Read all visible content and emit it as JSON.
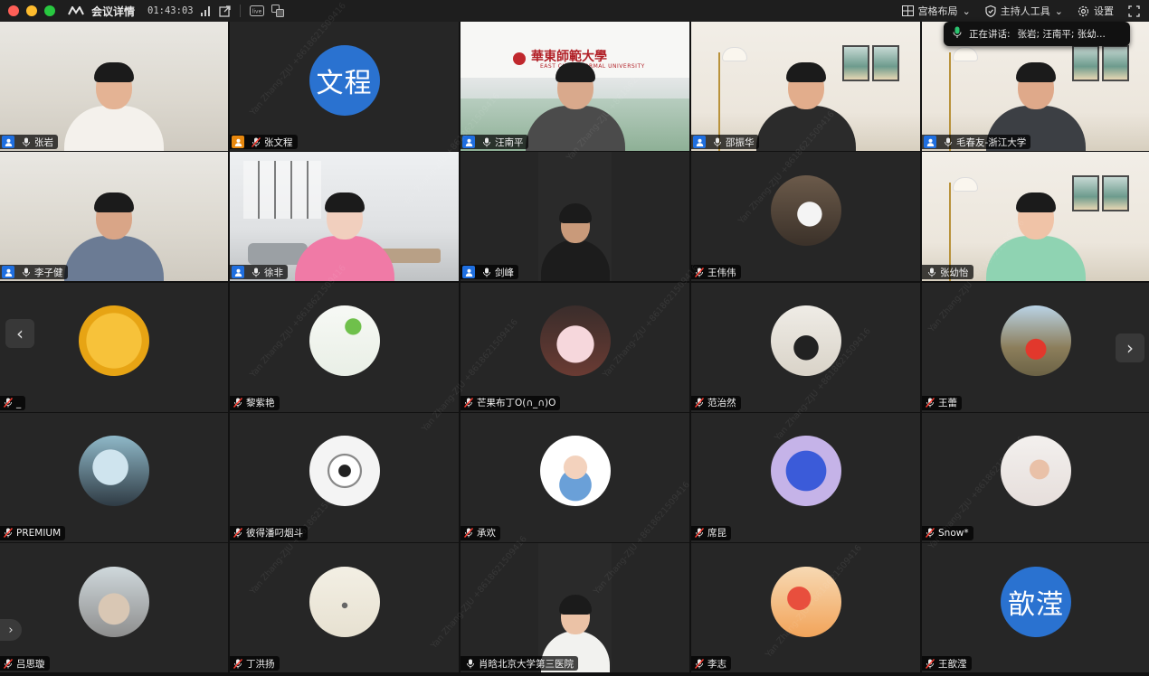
{
  "titlebar": {
    "meeting_info_label": "会议详情",
    "elapsed_time": "01:43:03",
    "right": {
      "layout_label": "宫格布局",
      "host_tools_label": "主持人工具",
      "settings_label": "设置"
    }
  },
  "speaking": {
    "label": "正在讲话:",
    "names": "张岩; 汪南平; 张幼..."
  },
  "participants": [
    {
      "name": "张岩",
      "kind": "video",
      "host": true,
      "host_color": "#1f6fe0",
      "active": true
    },
    {
      "name": "张文程",
      "kind": "text-avatar",
      "avatar_text": "文程",
      "host": true,
      "host_color": "#e8880e"
    },
    {
      "name": "汪南平",
      "kind": "video",
      "host": true,
      "host_color": "#1f6fe0",
      "banner": "華東師範大學",
      "banner_en": "EAST CHINA NORMAL UNIVERSITY"
    },
    {
      "name": "邵振华",
      "kind": "video",
      "host": true,
      "host_color": "#1f6fe0"
    },
    {
      "name": "毛春友-浙江大学",
      "kind": "video",
      "host": true,
      "host_color": "#1f6fe0"
    },
    {
      "name": "李子健",
      "kind": "video",
      "host": true,
      "host_color": "#1f6fe0"
    },
    {
      "name": "徐非",
      "kind": "video",
      "host": true,
      "host_color": "#1f6fe0"
    },
    {
      "name": "剑峰",
      "kind": "video",
      "host": true,
      "host_color": "#1f6fe0"
    },
    {
      "name": "王伟伟",
      "kind": "avatar",
      "avatar": "cat-photo-avatar"
    },
    {
      "name": "张幼怡",
      "kind": "video",
      "host": false
    },
    {
      "name": "_",
      "kind": "avatar",
      "avatar": "golden-mascot-avatar"
    },
    {
      "name": "黎紫艳",
      "kind": "avatar",
      "avatar": "plant-photo-avatar"
    },
    {
      "name": "芒果布丁O(∩_∩)O",
      "kind": "avatar",
      "avatar": "plush-toy-avatar"
    },
    {
      "name": "范治然",
      "kind": "avatar",
      "avatar": "child-photo-avatar"
    },
    {
      "name": "王蕾",
      "kind": "avatar",
      "avatar": "landscape-photo-avatar"
    },
    {
      "name": "PREMIUM",
      "kind": "avatar",
      "avatar": "anime-character-avatar"
    },
    {
      "name": "彼得潘叼烟斗",
      "kind": "avatar",
      "avatar": "eye-sketch-avatar"
    },
    {
      "name": "承欢",
      "kind": "avatar",
      "avatar": "cartoon-girl-avatar"
    },
    {
      "name": "席昆",
      "kind": "avatar",
      "avatar": "molecule-avatar"
    },
    {
      "name": "Snow*",
      "kind": "avatar",
      "avatar": "zju-photo-avatar"
    },
    {
      "name": "吕思璇",
      "kind": "avatar",
      "avatar": "group-photo-avatar"
    },
    {
      "name": "丁洪扬",
      "kind": "avatar",
      "avatar": "ink-painting-avatar"
    },
    {
      "name": "肖晗北京大学第三医院",
      "kind": "video",
      "host": false
    },
    {
      "name": "李志",
      "kind": "avatar",
      "avatar": "cartoon-scene-avatar"
    },
    {
      "name": "王歆滢",
      "kind": "text-avatar",
      "avatar_text": "歆滢"
    }
  ],
  "watermark_text": "Yan Zhang-ZJU +8618621509416",
  "colors": {
    "active_speaker_border": "#1f8e4a",
    "host_badge_blue": "#1f6fe0",
    "host_badge_orange": "#e8880e",
    "text_avatar_blue": "#2a72d0"
  }
}
